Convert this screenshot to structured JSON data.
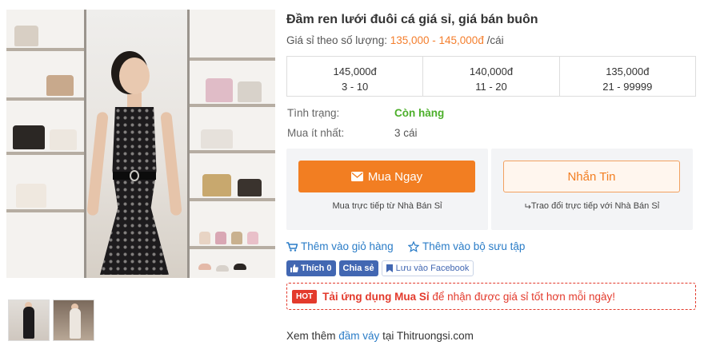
{
  "product": {
    "title": "Đầm ren lưới đuôi cá giá sỉ, giá bán buôn",
    "price_prefix": "Giá sỉ theo số lượng:",
    "price_range": "135,000 - 145,000đ",
    "price_suffix": "/cái",
    "tiers": [
      {
        "price": "145,000đ",
        "qty": "3 - 10"
      },
      {
        "price": "140,000đ",
        "qty": "11 - 20"
      },
      {
        "price": "135,000đ",
        "qty": "21 - 99999"
      }
    ],
    "status_label": "Tình trạng:",
    "status_value": "Còn hàng",
    "min_label": "Mua ít nhất:",
    "min_value": "3 cái"
  },
  "actions": {
    "buy_label": "Mua Ngay",
    "buy_sub": "Mua trực tiếp từ Nhà Bán Sỉ",
    "msg_label": "Nhắn Tin",
    "msg_sub": "Trao đổi trực tiếp với Nhà Bán Sỉ",
    "cart_label": "Thêm vào giỏ hàng",
    "collection_label": "Thêm vào bộ sưu tập"
  },
  "social": {
    "like_label": "Thích 0",
    "share_label": "Chia sẻ",
    "save_label": "Lưu vào Facebook"
  },
  "banner": {
    "tag": "HOT",
    "link_text": "Tải ứng dụng Mua Sỉ",
    "rest_text": " để nhận được giá sỉ tốt hơn mỗi ngày!"
  },
  "footer": {
    "prefix": "Xem thêm ",
    "link": "đầm váy",
    "suffix": " tại Thitruongsi.com"
  },
  "colors": {
    "accent": "#f27e22",
    "price": "#f47e2c",
    "link": "#2a7cc7",
    "stock": "#4caf2a",
    "hot": "#e33a2c",
    "facebook": "#4267b2"
  },
  "icons": [
    "envelope-icon",
    "cart-icon",
    "star-outline-icon",
    "thumbs-up-icon",
    "bookmark-icon",
    "reply-icon"
  ]
}
